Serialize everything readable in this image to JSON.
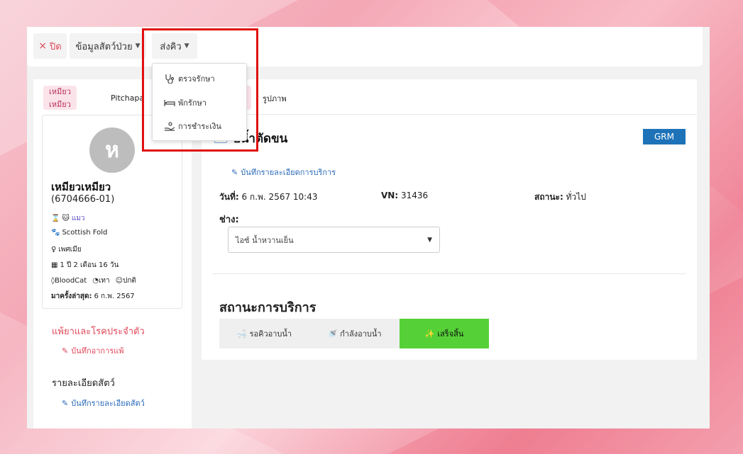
{
  "topbar": {
    "close_label": "ปิด",
    "pet_info_label": "ข้อมูลสัตว์ป่วย",
    "send_queue_label": "ส่งคิว"
  },
  "dropdown": {
    "items": [
      {
        "label": "ตรวจรักษา",
        "icon": "stethoscope-icon"
      },
      {
        "label": "พักรักษา",
        "icon": "bed-icon"
      },
      {
        "label": "การชำระเงิน",
        "icon": "payment-hand-icon"
      }
    ]
  },
  "left": {
    "tabs": [
      {
        "label": "เหมียวเหมียว"
      },
      {
        "label": "Pitchapa"
      }
    ],
    "pet": {
      "avatar_letter": "ห",
      "name": "เหมียวเหมียว",
      "id": "(6704666-01)",
      "species": "แมว",
      "breed": "Scottish Fold",
      "sex": "เพศเมีย",
      "age": "1 ปี 2 เดือน 16 วัน",
      "blood": "BloodCat",
      "color": "เทา",
      "temper": "ปกติ",
      "last_visit_label": "มาครั้งล่าสุด:",
      "last_visit_value": "6 ก.พ. 2567"
    },
    "allergy_title": "แพ้ยาและโรคประจำตัว",
    "allergy_link": "บันทึกอาการแพ้",
    "detail_title": "รายละเอียดสัตว์",
    "detail_link": "บันทึกรายละเอียดสัตว์"
  },
  "right": {
    "photo_tab": "รูปภาพ",
    "service_title": "บน้ำตัดขน",
    "badge": "GRM",
    "service_link": "บันทึกรายละเอียดการบริการ",
    "date_label": "วันที่:",
    "date_value": "6 ก.พ. 2567 10:43",
    "vn_label": "VN:",
    "vn_value": "31436",
    "status_label": "สถานะ:",
    "status_value": "ทั่วไป",
    "tech_label": "ช่าง:",
    "tech_value": "ไอซ์ น้ำหวานเย็น",
    "service_status_title": "สถานะการบริการ",
    "status_buttons": [
      {
        "label": "รอคิวอาบน้ำ",
        "icon": "bathtub-icon"
      },
      {
        "label": "กำลังอาบน้ำ",
        "icon": "shower-icon"
      },
      {
        "label": "เสร็จสิ้น",
        "icon": "sparkles-icon"
      }
    ],
    "done_color": "#55d137"
  },
  "colors": {
    "accent_red": "#e0485a",
    "link_blue": "#2a6bb8",
    "badge_blue": "#1e73b8",
    "highlight": "#e01010"
  }
}
